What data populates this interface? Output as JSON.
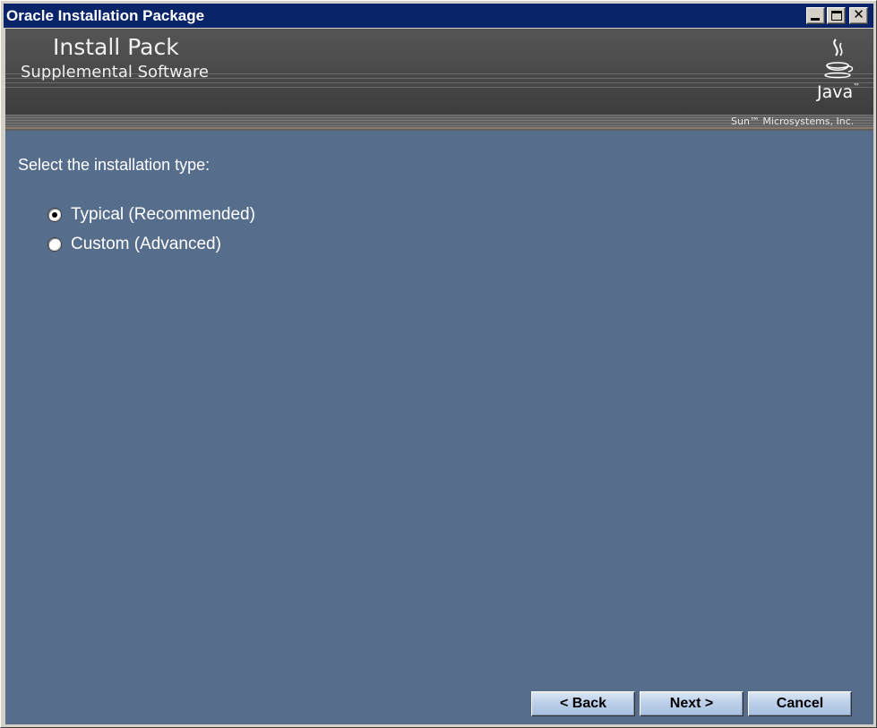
{
  "window": {
    "title": "Oracle Installation Package",
    "controls": {
      "minimize": "minimize-icon",
      "maximize": "maximize-icon",
      "close": "close-icon"
    }
  },
  "banner": {
    "title": "Install Pack",
    "subtitle": "Supplemental Software",
    "logo_text": "Java",
    "logo_tm": "™",
    "vendor": "Sun™ Microsystems, Inc."
  },
  "content": {
    "prompt": "Select the installation type:",
    "options": [
      {
        "label": "Typical (Recommended)",
        "selected": true
      },
      {
        "label": "Custom (Advanced)",
        "selected": false
      }
    ]
  },
  "buttons": {
    "back": "< Back",
    "next": "Next >",
    "cancel": "Cancel"
  },
  "colors": {
    "titlebar": "#0a246a",
    "content_bg": "#576d8c",
    "banner_bg": "#3a3a3a"
  }
}
